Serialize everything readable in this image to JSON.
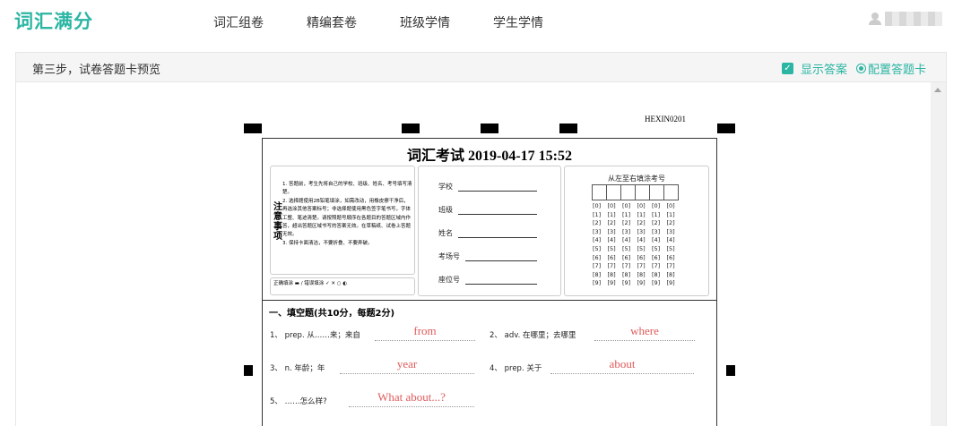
{
  "app": {
    "logo": "词汇满分",
    "nav": [
      "词汇组卷",
      "精编套卷",
      "班级学情",
      "学生学情"
    ]
  },
  "stepbar": {
    "title": "第三步，试卷答题卡预览",
    "show_answer": "显示答案",
    "config_card": "配置答题卡"
  },
  "sheet": {
    "code": "HEXIN0201",
    "title": "词汇考试 2019-04-17 15:52",
    "instructions_label": "注意事项",
    "instructions": "1. 答题前，考生先将自己的学校、班级、姓名、考号填写清楚。\n2. 选择题使用2B铅笔填涂，如需改动，用橡皮擦干净后，再选涂其他答案标号；非选择题使用黑色签字笔书写，字体工整、笔迹清楚。请按照题号顺序在各题目的答题区域内作答，超出答题区域书写的答案无效。在草稿纸、试卷上答题无效。\n3. 保持卡面清洁，不要折叠、不要弄破。",
    "legend": "正确填涂 ▬ / 错误填涂 ✓ ✕ ○ ◐",
    "fields": [
      "学校",
      "班级",
      "姓名",
      "考场号",
      "座位号"
    ],
    "number_title": "从左至右填涂考号",
    "digits": [
      "[0]",
      "[1]",
      "[2]",
      "[3]",
      "[4]",
      "[5]",
      "[6]",
      "[7]",
      "[8]",
      "[9]"
    ],
    "section_title": "一、填空题(共10分，每题2分)",
    "questions": [
      {
        "num": "1、",
        "prompt": "prep. 从……来；来自",
        "answer": "from"
      },
      {
        "num": "2、",
        "prompt": "adv. 在哪里；去哪里",
        "answer": "where"
      },
      {
        "num": "3、",
        "prompt": "n. 年龄；年",
        "answer": "year"
      },
      {
        "num": "4、",
        "prompt": "prep. 关于",
        "answer": "about"
      },
      {
        "num": "5、",
        "prompt": "……怎么样?",
        "answer": "What about...?"
      }
    ]
  }
}
